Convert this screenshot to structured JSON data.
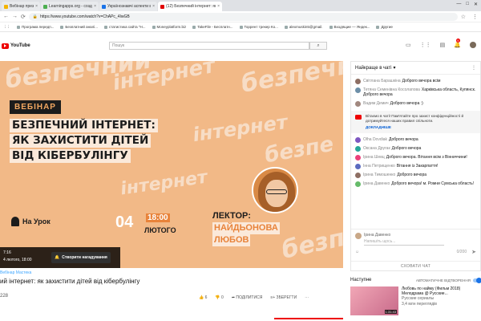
{
  "browser": {
    "tabs": [
      {
        "title": "Вебінар презентація",
        "color": "#f4b400",
        "active": false
      },
      {
        "title": "Learningapps.org - создание м...",
        "color": "#4caf50",
        "active": false
      },
      {
        "title": "Українознавчі аспекти викладі...",
        "color": "#1a73e8",
        "active": false
      },
      {
        "title": "(12) Безпечний інтернет: як захи...",
        "color": "#e00000",
        "active": true
      }
    ],
    "window_controls": [
      "—",
      "□",
      "✕"
    ],
    "url": "https://www.youtube.com/watch?v=ChAPc_4IwGB",
    "bookmarks": [
      "Програма передп...",
      "Безплатний аналі...",
      "статистика сайта \"Н...",
      "Moneyplatform.biz",
      "TakeFile - Бесплатн...",
      "Торрент трекер Ко...",
      "alexmuskin5@gmail.",
      "Входящие — Яндек...",
      "Другие"
    ]
  },
  "youtube": {
    "logo_text": "YouTube",
    "search_placeholder": "Пошук",
    "notification_count": "9"
  },
  "video": {
    "label": "ВЕБІНАР",
    "title_lines": [
      "БЕЗПЕЧНИЙ ІНТЕРНЕТ:",
      "ЯК ЗАХИСТИТИ ДІТЕЙ",
      "ВІД КІБЕРБУЛІНГУ"
    ],
    "brand": "На Урок",
    "date_day": "04",
    "date_month": "ЛЮТОГО",
    "time": "18:00",
    "lector_label": "ЛЕКТОР:",
    "lector_first": "НАЙДЬОНОВА",
    "lector_last": "ЛЮБОВ",
    "bg_words": [
      "безпечний",
      "інтернет",
      "безпечний",
      "інтернет",
      "безпе",
      "інтернет",
      "безпечний"
    ],
    "player_time": "7:16",
    "player_date": "4 лютого, 18:00",
    "remind_button": "Створити нагадування"
  },
  "below": {
    "channel": "Вебінар Мастека",
    "title": "ий інтернет: як захистити дітей від кібербулінгу",
    "views": "228",
    "likes": "6",
    "dislikes": "0",
    "share": "ПОДІЛИТИСЯ",
    "save": "ЗБЕРЕГТИ"
  },
  "chat": {
    "header": "Найкраще в чаті",
    "messages_top": [
      {
        "author": "Світлана Барашкіна",
        "text": "Доброго вечора всім",
        "color": "#8d6e63"
      },
      {
        "author": "Тетяна Семенівна Косолапова",
        "text": "Харківська область, Купянск. Доброго вечора",
        "color": "#6d8fa8"
      },
      {
        "author": "Вадим Демич",
        "text": "Доброго вечора :)",
        "color": "#a1887f"
      }
    ],
    "notice_text": "Вітаємо в чаті! Пам'ятайте про захист конфіденційності й дотримуйтеся наших правил спільноти.",
    "notice_link": "ДОКЛАДНІШЕ",
    "messages_bottom": [
      {
        "author": "Olha Dovdiak",
        "text": "Доброго вечора",
        "color": "#7e57c2"
      },
      {
        "author": "Оксана Другак",
        "text": "Доброго вечора",
        "color": "#26a69a"
      },
      {
        "author": "Ірина Шевц",
        "text": "Доброго вечора. Вітання всім з Вінниччини!",
        "color": "#ec407a"
      },
      {
        "author": "Інна Петрищенко",
        "text": "Вітання із Закарпаття!",
        "color": "#5c6bc0"
      },
      {
        "author": "Ірина Тимошенко",
        "text": "Доброго вечора",
        "color": "#8d6e63"
      },
      {
        "author": "Ірина Давенко",
        "text": "Доброго вечора! м. Ромни Сумська область!",
        "color": "#66bb6a"
      }
    ],
    "input_name": "Ірина Давенко",
    "input_placeholder": "Напишіть щось...",
    "counter": "0/200",
    "hide_label": "СХОВАТИ ЧАТ"
  },
  "upnext": {
    "title": "Наступне",
    "autoplay": "АВТОМАТИЧНЕ ВІДТВОРЕННЯ",
    "card_title": "Любовь по найму (Фильм 2018) Мелодрама @ Русские...",
    "card_channel": "Русские сериалы",
    "card_views": "3,4 млн переглядів",
    "card_duration": "1:31:43"
  }
}
